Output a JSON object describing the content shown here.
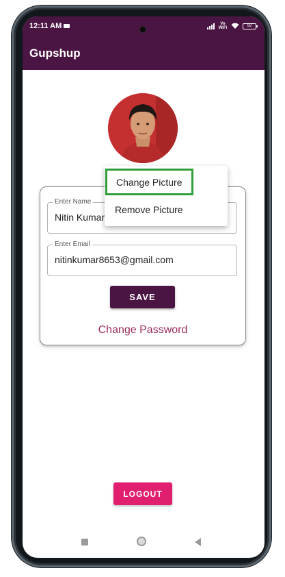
{
  "status_bar": {
    "time": "12:11 AM",
    "network_label": "Vo WiFi",
    "battery": "92"
  },
  "app": {
    "title": "Gupshup"
  },
  "profile": {
    "name_label": "Enter Name",
    "name_value": "Nitin Kumar",
    "email_label": "Enter Email",
    "email_value": "nitinkumar8653@gmail.com",
    "save_label": "SAVE",
    "change_password_label": "Change Password"
  },
  "picture_menu": {
    "items": [
      {
        "label": "Change Picture",
        "highlighted": true
      },
      {
        "label": "Remove Picture",
        "highlighted": false
      }
    ]
  },
  "logout_label": "LOGOUT",
  "nav": {
    "icons": [
      "recent-apps-icon",
      "home-icon",
      "back-icon"
    ]
  },
  "colors": {
    "primary": "#4a1542",
    "accent": "#e0206e",
    "link": "#9b2b5e",
    "highlight_border": "#2f9e39"
  }
}
